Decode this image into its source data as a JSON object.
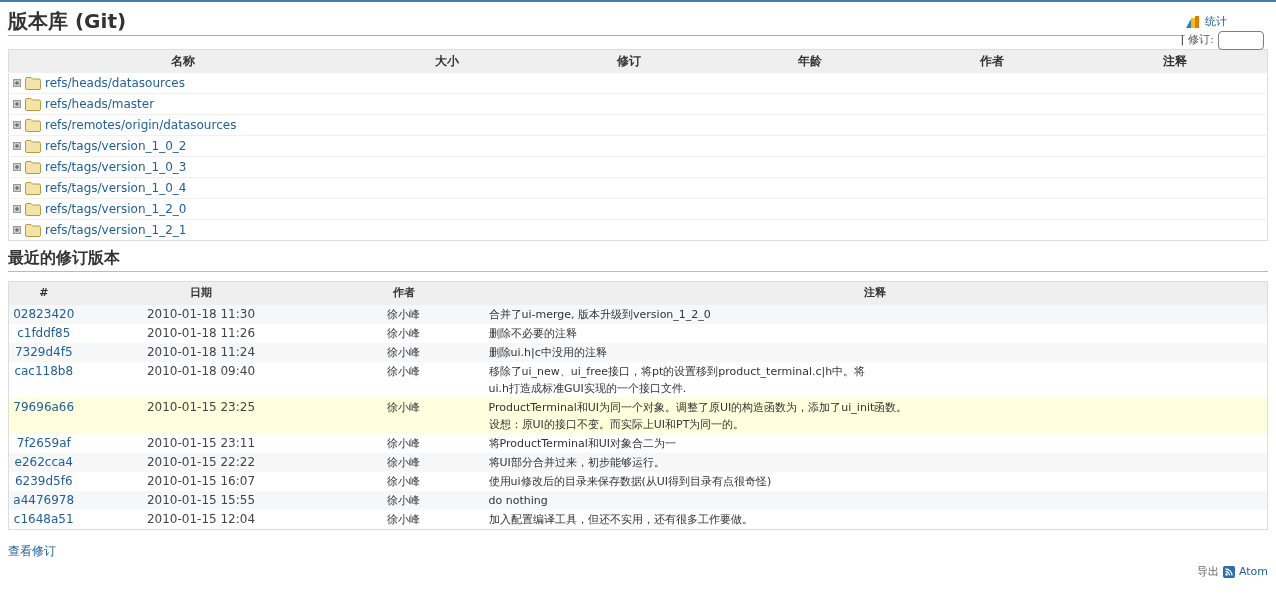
{
  "title": "版本库 (Git)",
  "ctxnav": {
    "stats": "统计",
    "separator": "|",
    "rev_label": "修订:"
  },
  "dir_table": {
    "columns": [
      "名称",
      "大小",
      "修订",
      "年龄",
      "作者",
      "注释"
    ],
    "rows": [
      {
        "name": "refs/heads/datasources",
        "expanded": false
      },
      {
        "name": "refs/heads/master",
        "expanded": false
      },
      {
        "name": "refs/remotes/origin/datasources",
        "expanded": false
      },
      {
        "name": "refs/tags/version_1_0_2",
        "expanded": false
      },
      {
        "name": "refs/tags/version_1_0_3",
        "expanded": false
      },
      {
        "name": "refs/tags/version_1_0_4",
        "expanded": false
      },
      {
        "name": "refs/tags/version_1_2_0",
        "expanded": false
      },
      {
        "name": "refs/tags/version_1_2_1",
        "expanded": false
      }
    ]
  },
  "changes_title": "最近的修订版本",
  "changes_table": {
    "columns": [
      "#",
      "日期",
      "作者",
      "注释"
    ],
    "rows": [
      {
        "rev": "02823420",
        "date": "2010-01-18 11:30",
        "author": "徐小峰",
        "message": [
          "合并了ui-merge, 版本升级到version_1_2_0"
        ],
        "selected": false
      },
      {
        "rev": "c1fddf85",
        "date": "2010-01-18 11:26",
        "author": "徐小峰",
        "message": [
          "删除不必要的注释"
        ],
        "selected": false
      },
      {
        "rev": "7329d4f5",
        "date": "2010-01-18 11:24",
        "author": "徐小峰",
        "message": [
          "删除ui.h|c中没用的注释"
        ],
        "selected": false
      },
      {
        "rev": "cac118b8",
        "date": "2010-01-18 09:40",
        "author": "徐小峰",
        "message": [
          "移除了ui_new、ui_free接口，将pt的设置移到product_terminal.c|h中。将",
          "ui.h打造成标准GUI实现的一个接口文件."
        ],
        "selected": false
      },
      {
        "rev": "79696a66",
        "date": "2010-01-15 23:25",
        "author": "徐小峰",
        "message": [
          "ProductTerminal和UI为同一个对象。调整了原UI的构造函数为，添加了ui_init函数。",
          "设想：原UI的接口不变。而实际上UI和PT为同一的。"
        ],
        "selected": true
      },
      {
        "rev": "7f2659af",
        "date": "2010-01-15 23:11",
        "author": "徐小峰",
        "message": [
          "将ProductTerminal和UI对象合二为一"
        ],
        "selected": false
      },
      {
        "rev": "e262cca4",
        "date": "2010-01-15 22:22",
        "author": "徐小峰",
        "message": [
          "将UI部分合并过来，初步能够运行。"
        ],
        "selected": false
      },
      {
        "rev": "6239d5f6",
        "date": "2010-01-15 16:07",
        "author": "徐小峰",
        "message": [
          "使用ui修改后的目录来保存数据(从UI得到目录有点很奇怪)"
        ],
        "selected": false
      },
      {
        "rev": "a4476978",
        "date": "2010-01-15 15:55",
        "author": "徐小峰",
        "message": [
          "do nothing"
        ],
        "selected": false
      },
      {
        "rev": "c1648a51",
        "date": "2010-01-15 12:04",
        "author": "徐小峰",
        "message": [
          "加入配置编译工具，但还不实用，还有很多工作要做。"
        ],
        "selected": false
      }
    ]
  },
  "view_changes_link": "查看修订",
  "footer": {
    "export_label": "导出",
    "atom": "Atom"
  }
}
